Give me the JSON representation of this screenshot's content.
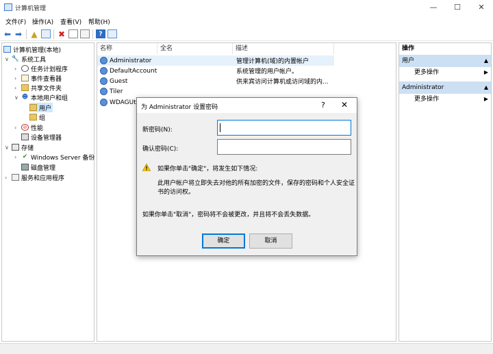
{
  "window": {
    "title": "计算机管理",
    "min": "—",
    "max": "☐",
    "close": "✕"
  },
  "menu": [
    "文件(F)",
    "操作(A)",
    "查看(V)",
    "帮助(H)"
  ],
  "tree": {
    "root": "计算机管理(本地)",
    "system_tools": "系统工具",
    "task_scheduler": "任务计划程序",
    "event_viewer": "事件查看器",
    "shared_folders": "共享文件夹",
    "local_users": "本地用户和组",
    "users": "用户",
    "groups": "组",
    "performance": "性能",
    "device_manager": "设备管理器",
    "storage": "存储",
    "ws_backup": "Windows Server 备份",
    "disk_mgmt": "磁盘管理",
    "services_apps": "服务和应用程序"
  },
  "list": {
    "columns": [
      "名称",
      "全名",
      "描述"
    ],
    "rows": [
      {
        "name": "Administrator",
        "desc": "管理计算机(域)的内置帐户"
      },
      {
        "name": "DefaultAccount",
        "desc": "系统管理的用户帐户。"
      },
      {
        "name": "Guest",
        "desc": "供来宾访问计算机或访问域的内..."
      },
      {
        "name": "Tiler",
        "desc": ""
      },
      {
        "name": "WDAGUtil",
        "desc": ""
      }
    ]
  },
  "actions": {
    "header": "操作",
    "section1": "用户",
    "more1": "更多操作",
    "section2": "Administrator",
    "more2": "更多操作"
  },
  "dialog": {
    "title": "为 Administrator 设置密码",
    "help": "?",
    "close": "✕",
    "new_pw_label": "新密码(N):",
    "confirm_pw_label": "确认密码(C):",
    "warn_title": "如果你单击\"确定\"，将发生如下情况:",
    "warn_line1": "此用户帐户将立即失去对他的所有加密的文件，保存的密码和个人安全证",
    "warn_line2": "书的访问权。",
    "cancel_note": "如果你单击\"取消\"，密码将不会被更改，并且将不会丢失数据。",
    "ok": "确定",
    "cancel": "取消"
  }
}
